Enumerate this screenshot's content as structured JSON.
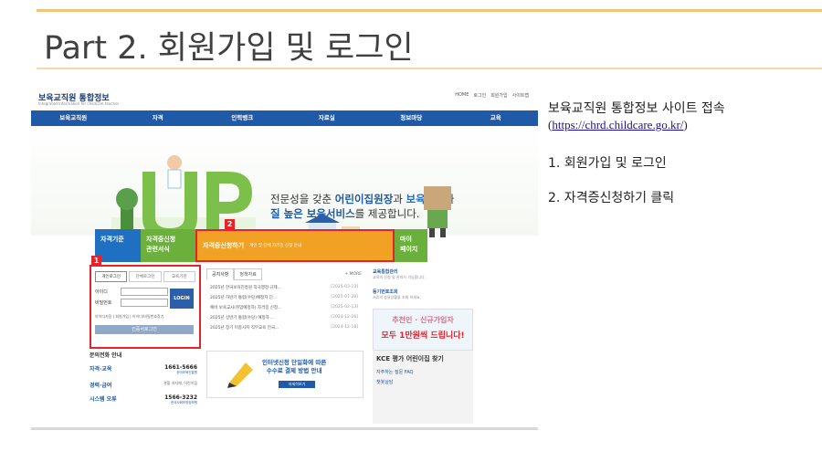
{
  "slide": {
    "title": "Part 2. 회원가입 및 로그인"
  },
  "website": {
    "logo": "보육교직원 통합정보",
    "logo_sub": "Integrated Information for childcare teacher",
    "util_links": [
      "HOME",
      "로그인",
      "회원가입",
      "사이트맵"
    ],
    "nav": [
      "보육교직원",
      "자격",
      "인력뱅크",
      "자료실",
      "정보마당",
      "교육"
    ],
    "hero": {
      "line1_a": "전문성을 갖춘 ",
      "line1_b": "어린이집원장",
      "line1_c": "과 ",
      "line1_d": "보육교사",
      "line1_e": "가",
      "line2_a": "질 높은 보육서비스",
      "line2_b": "를 제공합니다."
    },
    "tiles": {
      "t1": "자격기준",
      "t2a": "자격증신청",
      "t2b": "관련서식",
      "t3": "자격증신청하기",
      "t3_small": "개인 및 단체 자격증 신청 안내",
      "t4a": "마이",
      "t4b": "페이지"
    },
    "markers": {
      "m1": "1",
      "m2": "2"
    },
    "login": {
      "tabs": [
        "개인로그인",
        "단체로그인",
        "교육기관"
      ],
      "id_label": "아이디",
      "pw_label": "비밀번호",
      "button": "LOGIN",
      "links": "아이디저장 | 회원가입 | 아이디/비밀번호찾기",
      "cert": "인증서로그인"
    },
    "notice": {
      "tabs": [
        "공지사항",
        "정책자료"
      ],
      "more": "+ MORE",
      "rows": [
        {
          "title": "2025년 한국보육진흥원 직극행정·규제...",
          "date": "[2025-03-13]"
        },
        {
          "title": "2025년 하반기 통합(수당)예정자 단...",
          "date": "[2025-07-28]"
        },
        {
          "title": "예비 보육교사(취업예정자) 자격증 신청...",
          "date": "[2025-02-13]"
        },
        {
          "title": "2025년 상반기 통합(수당) 예정자 ...",
          "date": "[2024-12-26]"
        },
        {
          "title": "2025년 장기 미종사자 직무교육 전국...",
          "date": "[2024-12-18]"
        }
      ]
    },
    "right": {
      "edu_title": "교육통합관리",
      "edu_sub": "교육의 신청 및 관리가 가능합니다.",
      "reg_title": "등기번호조회",
      "reg_sub": "서류의 송달상황을 조회 하세요.",
      "banner1": "추천인 · 신규가입자",
      "banner2": "모두 1만원씩 드립니다!"
    },
    "helpdesk": {
      "title": "문의전화 안내",
      "rows": [
        {
          "label": "자격·교육",
          "num": "1661-5666",
          "org": "한국보육진흥원"
        },
        {
          "label": "경력·급여",
          "num": "관할 지자체, 어린이집",
          "org": ""
        },
        {
          "label": "시스템 오류",
          "num": "1566-3232",
          "org": "한국사회보장정보원"
        }
      ]
    },
    "pay": {
      "line1": "인터넷신청 단일화에 따른",
      "line2": "수수료 결제 방법 안내",
      "button": "자세히보기"
    },
    "kce": {
      "head": "KCE 평가 어린이집 찾기",
      "faq": "자주하는 질문 FAQ",
      "chat": "챗봇상담"
    }
  },
  "side": {
    "title": "보육교직원 통합정보 사이트 접속",
    "link_open": "(",
    "link": "https://chrd.childcare.go.kr/",
    "link_close": ")",
    "steps": [
      "1.  회원가입 및 로그인",
      "2.  자격증신청하기 클릭"
    ]
  }
}
